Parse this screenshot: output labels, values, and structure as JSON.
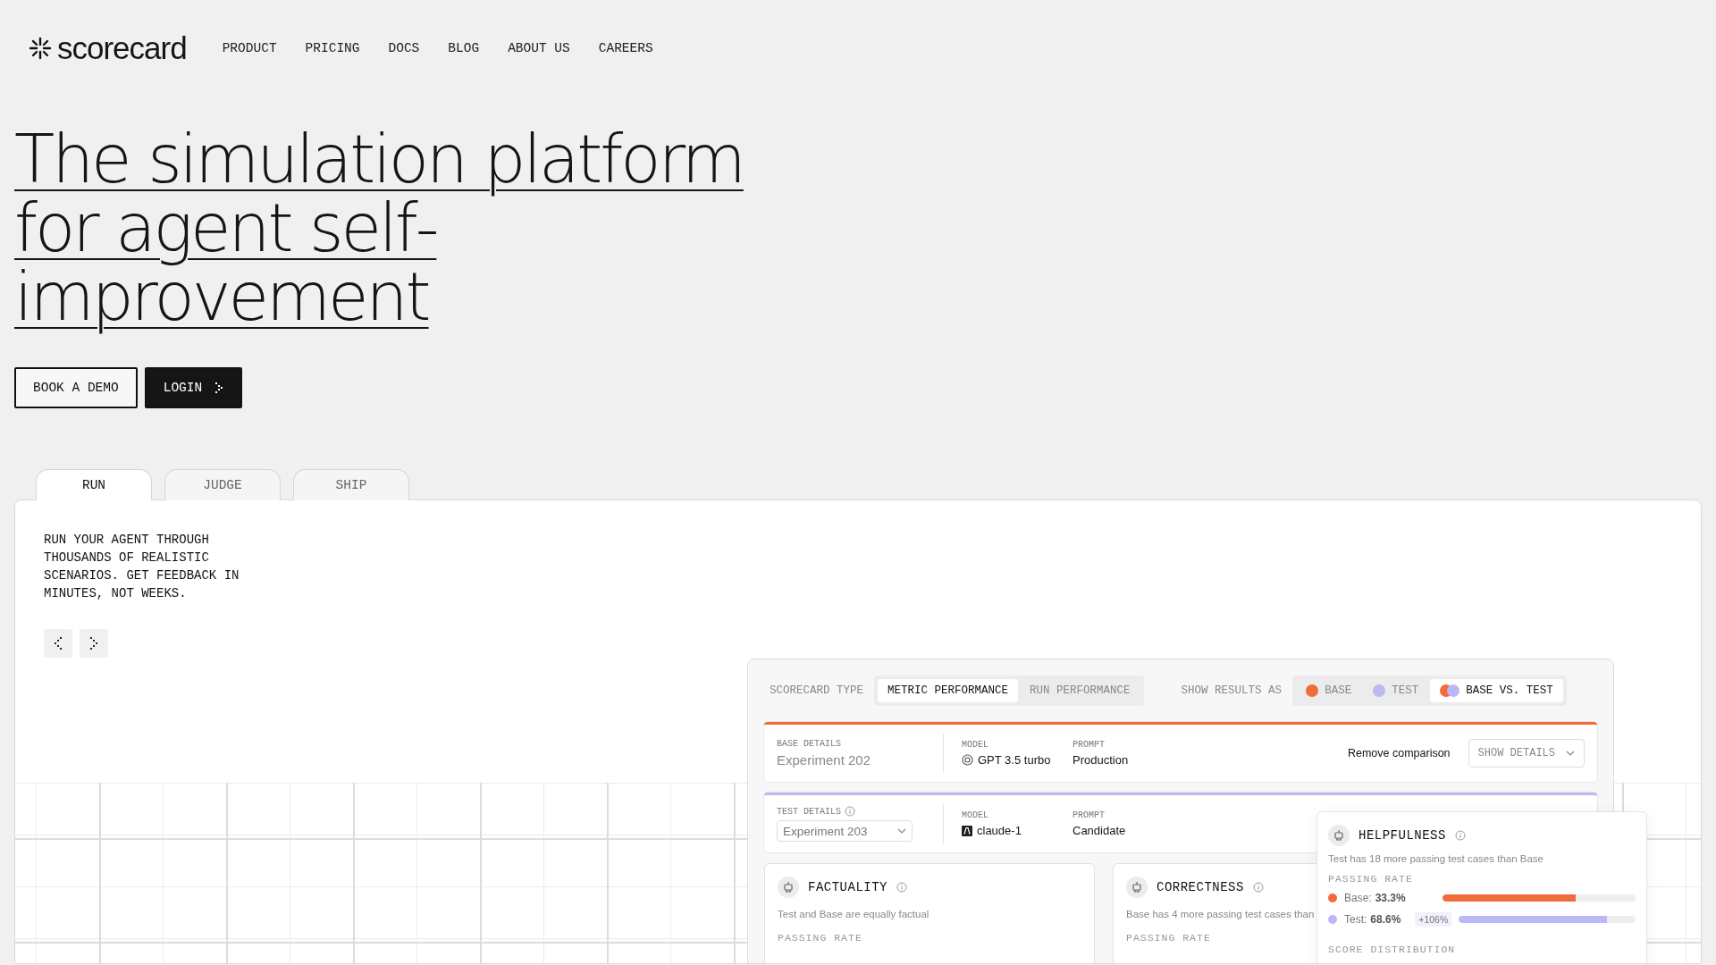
{
  "logo": {
    "text": "scorecard"
  },
  "nav": [
    {
      "label": "PRODUCT"
    },
    {
      "label": "PRICING"
    },
    {
      "label": "DOCS"
    },
    {
      "label": "BLOG"
    },
    {
      "label": "ABOUT US"
    },
    {
      "label": "CAREERS"
    }
  ],
  "headline": "The simulation platform for agent self-improvement",
  "buttons": [
    {
      "label": "BOOK A DEMO",
      "kind": "outline"
    },
    {
      "label": "LOGIN",
      "kind": "filled"
    }
  ],
  "tabs": [
    {
      "label": "RUN",
      "selected": true
    },
    {
      "label": "JUDGE",
      "selected": false
    },
    {
      "label": "SHIP",
      "selected": false
    }
  ],
  "panel": {
    "description": "RUN YOUR AGENT THROUGH THOUSANDS OF REALISTIC SCENARIOS. GET FEEDBACK IN MINUTES, NOT WEEKS."
  },
  "dashboard": {
    "scorecard_type": {
      "label": "SCORECARD TYPE",
      "options": [
        {
          "label": "METRIC PERFORMANCE",
          "selected": true
        },
        {
          "label": "RUN PERFORMANCE",
          "selected": false
        }
      ]
    },
    "show_results": {
      "label": "SHOW RESULTS AS",
      "options": [
        {
          "label": "BASE",
          "kind": "base",
          "selected": false
        },
        {
          "label": "TEST",
          "kind": "test",
          "selected": false
        },
        {
          "label": "BASE VS. TEST",
          "kind": "both",
          "selected": true
        }
      ]
    },
    "base": {
      "label": "BASE DETAILS",
      "name": "Experiment 202",
      "model_label": "MODEL",
      "model": "GPT 3.5 turbo",
      "prompt_label": "PROMPT",
      "prompt": "Production",
      "remove": "Remove comparison",
      "details_button": "SHOW DETAILS"
    },
    "test": {
      "label": "TEST DETAILS",
      "name": "Experiment 203",
      "model_label": "MODEL",
      "model": "claude-1",
      "prompt_label": "PROMPT",
      "prompt": "Candidate"
    },
    "metrics": [
      {
        "title": "FACTUALITY",
        "summary": "Test and Base are equally factual",
        "section": "PASSING RATE"
      },
      {
        "title": "CORRECTNESS",
        "summary": "Base has 4 more passing test cases than",
        "section": "PASSING RATE"
      }
    ],
    "highlight": {
      "title": "HELPFULNESS",
      "summary": "Test has 18 more passing test cases than Base",
      "section": "PASSING RATE",
      "rates": [
        {
          "label": "Base:",
          "value": "33.3%",
          "level": 0.69,
          "color": "#f26b3a"
        },
        {
          "label": "Test:",
          "value": "68.6%",
          "change": "+106%",
          "level": 0.84,
          "color": "#bbb8f6"
        }
      ],
      "distribution_label": "SCORE DISTRIBUTION"
    }
  }
}
